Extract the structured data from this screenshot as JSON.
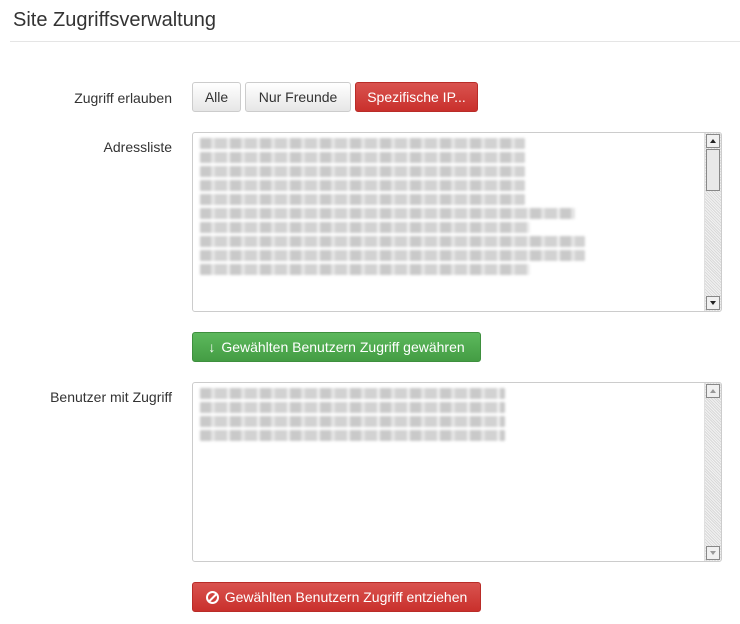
{
  "header": {
    "title": "Site Zugriffsverwaltung"
  },
  "access": {
    "label": "Zugriff erlauben",
    "options": [
      "Alle",
      "Nur Freunde",
      "Spezifische IP..."
    ]
  },
  "address_list": {
    "label": "Adressliste",
    "value_visible": "redacted"
  },
  "grant_button": {
    "label": "Gewählten Benutzern Zugriff gewähren",
    "icon": "arrow-down-icon"
  },
  "users_with_access": {
    "label": "Benutzer mit Zugriff",
    "value_visible": "redacted"
  },
  "revoke_button": {
    "label": "Gewählten Benutzern Zugriff entziehen",
    "icon": "ban-icon"
  },
  "colors": {
    "danger": "#d9534f",
    "success": "#5cb85c",
    "default_border": "#cccccc"
  }
}
